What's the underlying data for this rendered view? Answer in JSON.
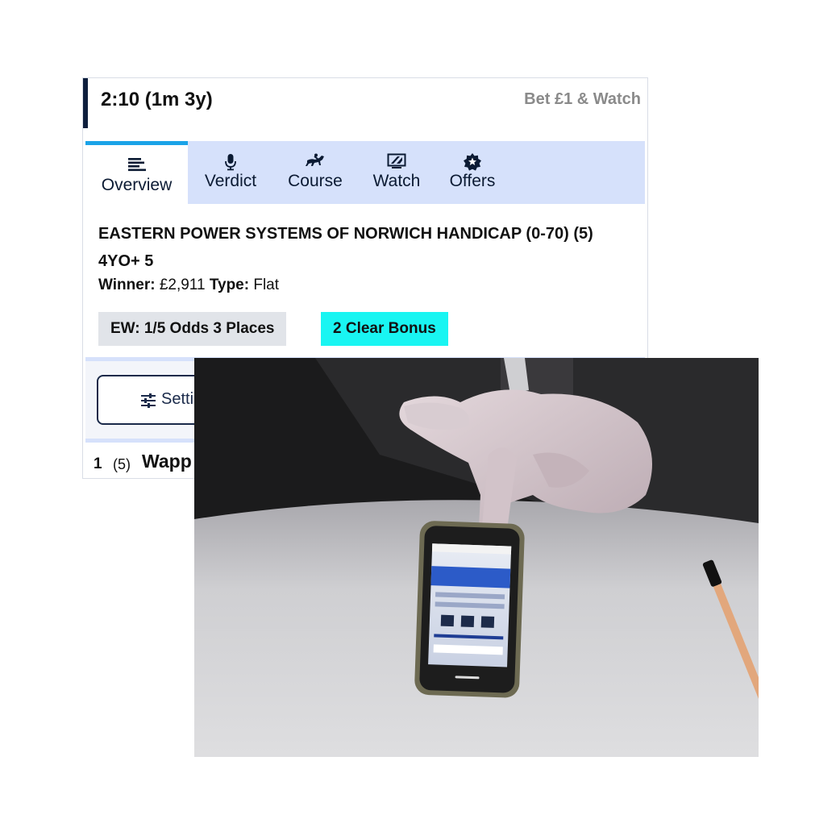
{
  "race": {
    "time": "2:10 (1m 3y)",
    "bet_watch": "Bet £1 & Watch",
    "name": "EASTERN POWER SYSTEMS OF NORWICH HANDICAP (0-70) (5) 4YO+ 5",
    "winner_label": "Winner:",
    "winner_value": "£2,911",
    "type_label": "Type:",
    "type_value": "Flat",
    "ew_badge": "EW: 1/5 Odds 3 Places",
    "bonus_badge": "2 Clear Bonus"
  },
  "tabs": [
    {
      "label": "Overview",
      "icon": "list-icon",
      "active": true
    },
    {
      "label": "Verdict",
      "icon": "microphone-icon",
      "active": false
    },
    {
      "label": "Course",
      "icon": "horse-jockey-icon",
      "active": false
    },
    {
      "label": "Watch",
      "icon": "tv-icon",
      "active": false
    },
    {
      "label": "Offers",
      "icon": "star-badge-icon",
      "active": false
    }
  ],
  "settings": {
    "label": "Setti",
    "icon": "sliders-icon"
  },
  "runner": {
    "number": "1",
    "draw": "(5)",
    "name": "Wapp"
  },
  "colors": {
    "header_accent": "#0e1f3d",
    "tab_bar": "#d6e1fb",
    "active_tab_indicator": "#1aa3e8",
    "bonus_badge": "#19f5f2",
    "ew_badge": "#e1e4e9"
  }
}
